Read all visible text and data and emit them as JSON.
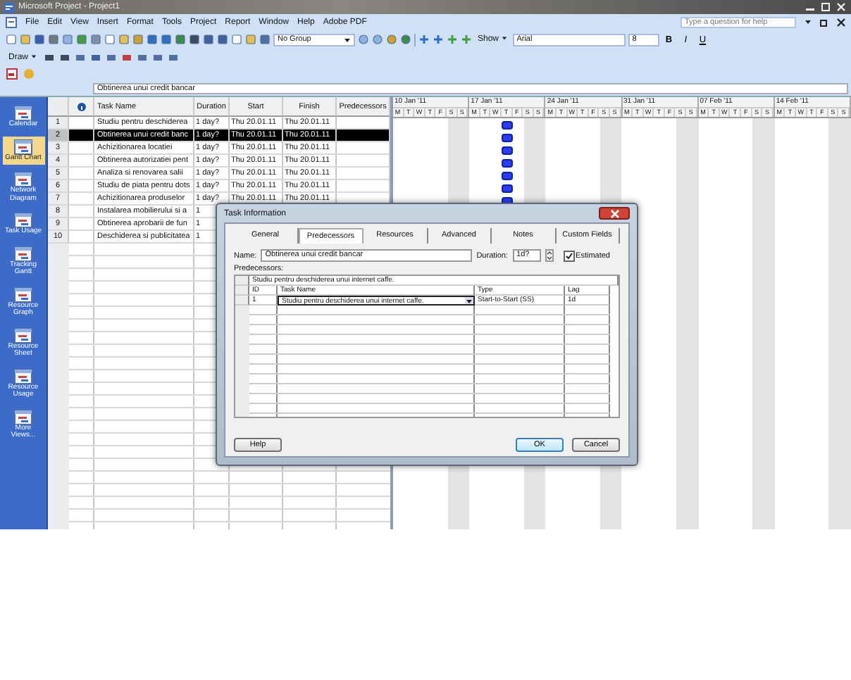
{
  "window": {
    "title": "Microsoft Project - Project1"
  },
  "menu": [
    "File",
    "Edit",
    "View",
    "Insert",
    "Format",
    "Tools",
    "Project",
    "Report",
    "Window",
    "Help",
    "Adobe PDF"
  ],
  "help_box": {
    "placeholder": "Type a question for help"
  },
  "toolbar": {
    "group_by": "No Group",
    "show": "Show",
    "font": "Arial",
    "font_size": "8",
    "format_buttons": [
      "B",
      "I",
      "U"
    ]
  },
  "draw_toolbar": {
    "label": "Draw"
  },
  "entry_bar": {
    "value": "Obtinerea unui credit bancar"
  },
  "view_bar": {
    "items": [
      {
        "label": "Calendar",
        "selected": false
      },
      {
        "label": "Gantt Chart",
        "selected": true
      },
      {
        "label": "Network Diagram",
        "selected": false
      },
      {
        "label": "Task Usage",
        "selected": false
      },
      {
        "label": "Tracking Gantt",
        "selected": false
      },
      {
        "label": "Resource Graph",
        "selected": false
      },
      {
        "label": "Resource Sheet",
        "selected": false
      },
      {
        "label": "Resource Usage",
        "selected": false
      },
      {
        "label": "More Views...",
        "selected": false
      }
    ]
  },
  "table": {
    "columns": [
      "Task Name",
      "Duration",
      "Start",
      "Finish",
      "Predecessors"
    ],
    "rows": [
      {
        "id": "1",
        "name": "Studiu pentru deschiderea",
        "duration": "1 day?",
        "start": "Thu 20.01.11",
        "finish": "Thu 20.01.11",
        "selected": false
      },
      {
        "id": "2",
        "name": "Obtinerea unui credit banc",
        "duration": "1 day?",
        "start": "Thu 20.01.11",
        "finish": "Thu 20.01.11",
        "selected": true
      },
      {
        "id": "3",
        "name": "Achizitionarea locatiei",
        "duration": "1 day?",
        "start": "Thu 20.01.11",
        "finish": "Thu 20.01.11",
        "selected": false
      },
      {
        "id": "4",
        "name": "Obtinerea autorizatiei pent",
        "duration": "1 day?",
        "start": "Thu 20.01.11",
        "finish": "Thu 20.01.11",
        "selected": false
      },
      {
        "id": "5",
        "name": "Analiza si renovarea salii",
        "duration": "1 day?",
        "start": "Thu 20.01.11",
        "finish": "Thu 20.01.11",
        "selected": false
      },
      {
        "id": "6",
        "name": "Studiu de piata pentru dots",
        "duration": "1 day?",
        "start": "Thu 20.01.11",
        "finish": "Thu 20.01.11",
        "selected": false
      },
      {
        "id": "7",
        "name": "Achizitionarea produselor",
        "duration": "1 day?",
        "start": "Thu 20.01.11",
        "finish": "Thu 20.01.11",
        "selected": false
      },
      {
        "id": "8",
        "name": "Instalarea mobilierului si a",
        "duration": "1",
        "selected": false
      },
      {
        "id": "9",
        "name": "Obtinerea aprobarii de fun",
        "duration": "1",
        "selected": false
      },
      {
        "id": "10",
        "name": "Deschiderea si publicitatea",
        "duration": "1",
        "selected": false
      }
    ]
  },
  "timescale": {
    "weeks": [
      {
        "label": "10 Jan '11",
        "days": [
          "M",
          "T",
          "W",
          "T",
          "F",
          "S",
          "S"
        ]
      },
      {
        "label": "17 Jan '11",
        "days": [
          "M",
          "T",
          "W",
          "T",
          "F",
          "S",
          "S"
        ]
      },
      {
        "label": "24 Jan '11",
        "days": [
          "M",
          "T",
          "W",
          "T",
          "F",
          "S",
          "S"
        ]
      },
      {
        "label": "31 Jan '11",
        "days": [
          "M",
          "T",
          "W",
          "T",
          "F",
          "S",
          "S"
        ]
      },
      {
        "label": "07 Feb '11",
        "days": [
          "M",
          "T",
          "W",
          "T",
          "F",
          "S",
          "S"
        ]
      },
      {
        "label": "14 Feb '11",
        "days": [
          "M",
          "T",
          "W",
          "T",
          "F",
          "S",
          "S"
        ]
      }
    ]
  },
  "dialog": {
    "title": "Task Information",
    "tabs": [
      {
        "label": "General",
        "selected": false
      },
      {
        "label": "Predecessors",
        "selected": true
      },
      {
        "label": "Resources",
        "selected": false
      },
      {
        "label": "Advanced",
        "selected": false
      },
      {
        "label": "Notes",
        "selected": false
      },
      {
        "label": "Custom Fields",
        "selected": false
      }
    ],
    "name_label": "Name:",
    "name": "Obtinerea unui credit bancar",
    "duration_label": "Duration:",
    "duration": "1d?",
    "estimated": {
      "label": "Estimated",
      "checked": true
    },
    "predecessors_label": "Predecessors:",
    "edit_value": "Studiu pentru deschiderea unui internet caffe.",
    "columns": [
      "ID",
      "Task Name",
      "Type",
      "Lag"
    ],
    "rows": [
      {
        "id": "1",
        "task_name": "Studiu pentru deschiderea unui internet caffe.",
        "type": "Start-to-Start (SS)",
        "lag": "1d"
      }
    ],
    "buttons": [
      "Help",
      "OK",
      "Cancel"
    ]
  }
}
